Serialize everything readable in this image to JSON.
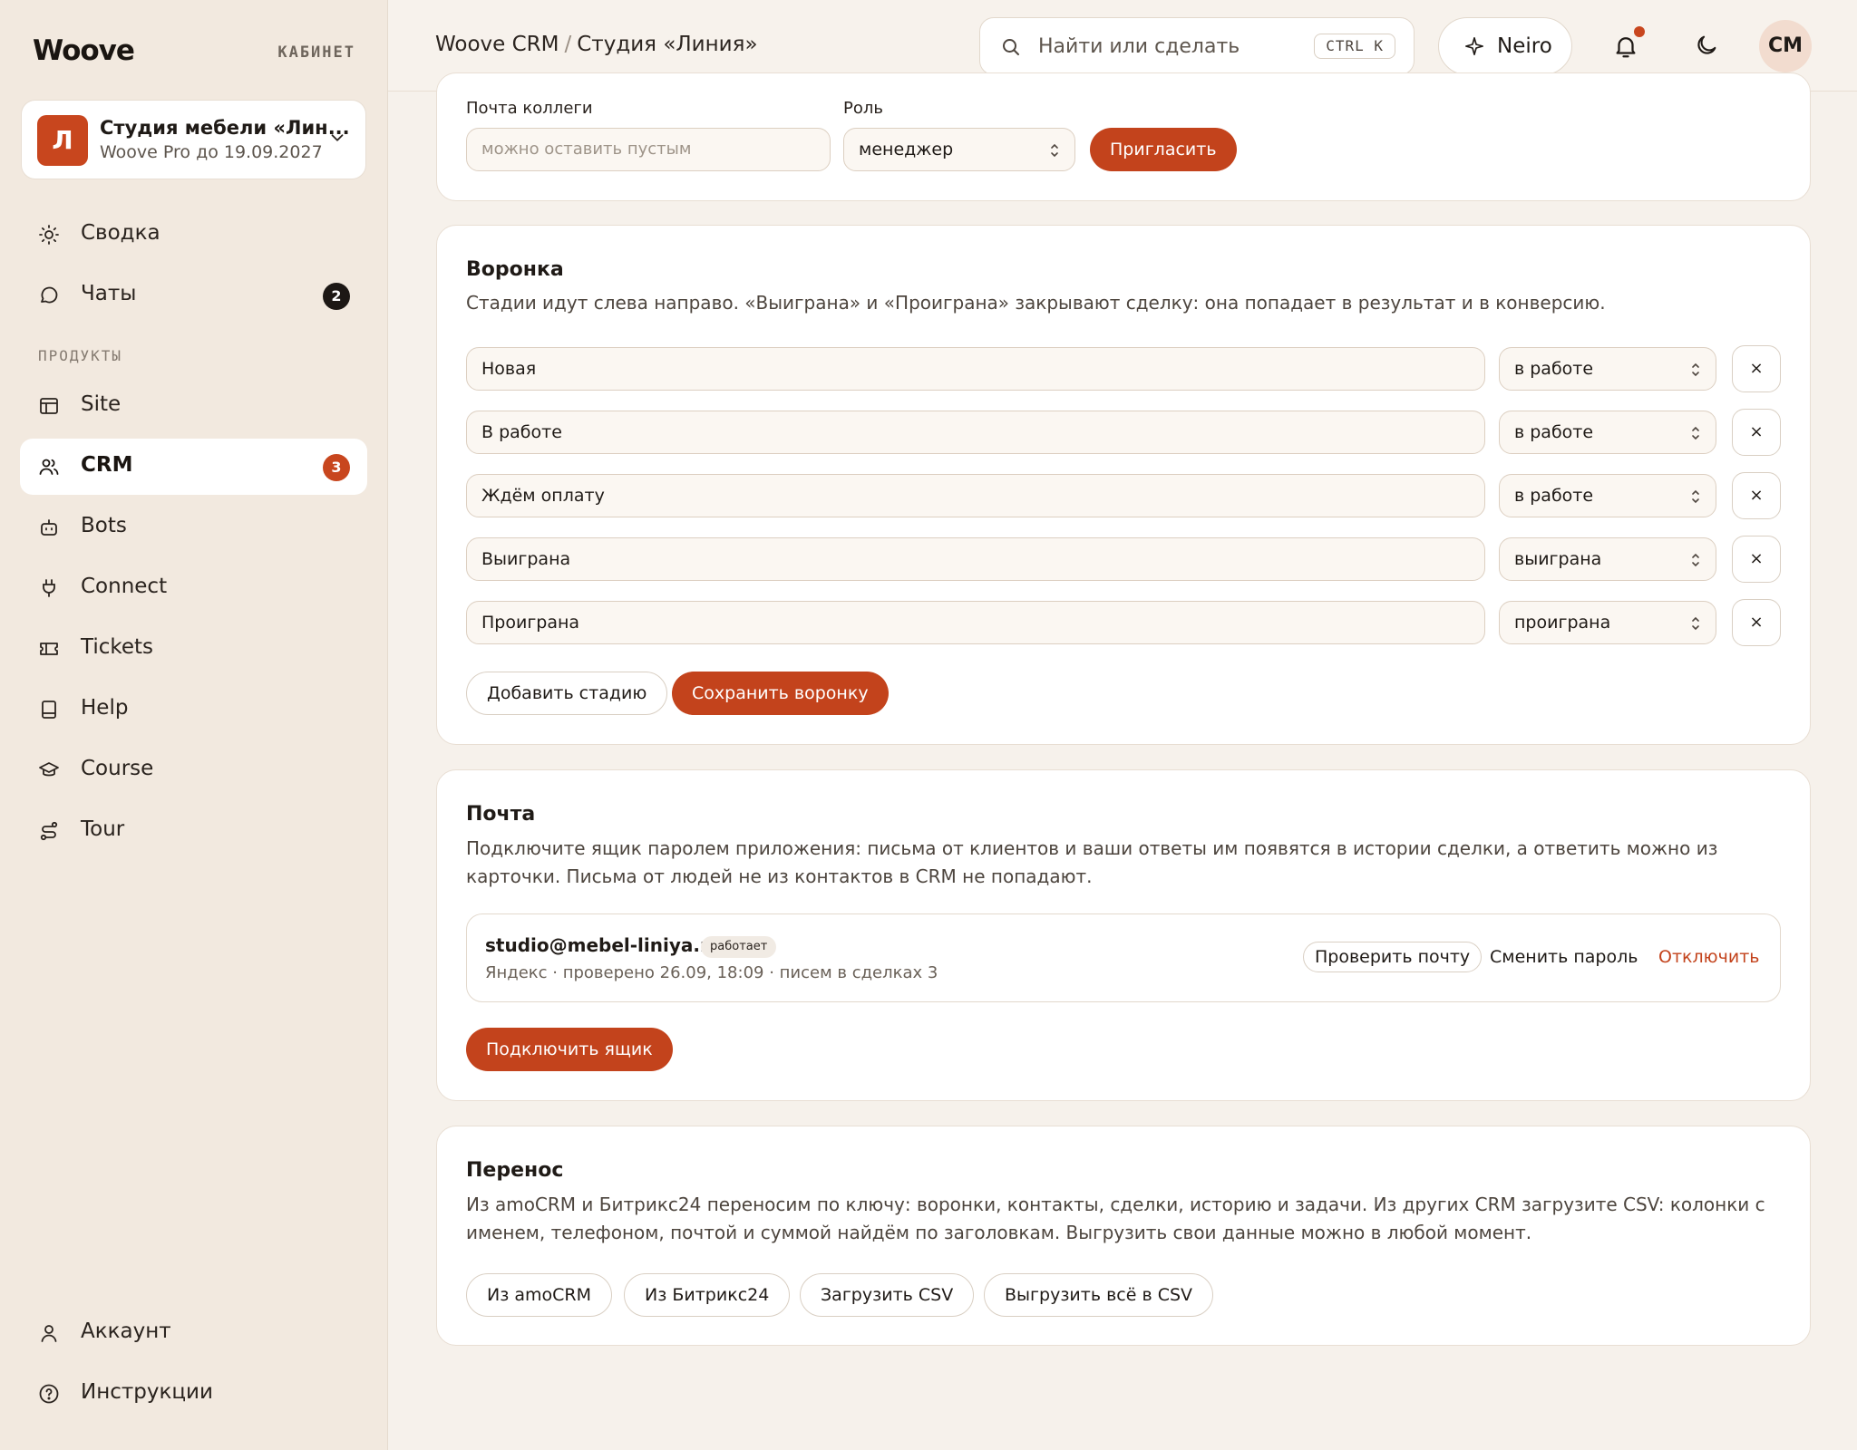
{
  "sidebar": {
    "brand": "Woove",
    "cabinet_label": "КАБИНЕТ",
    "org": {
      "initial": "Л",
      "name": "Студия мебели «Лин...",
      "plan": "Woove Pro до 19.09.2027"
    },
    "top_items": [
      {
        "label": "Сводка",
        "icon": "sun-icon"
      },
      {
        "label": "Чаты",
        "icon": "chat-bubble-icon",
        "badge": "2"
      }
    ],
    "products_label": "ПРОДУКТЫ",
    "product_items": [
      {
        "label": "Site",
        "icon": "layout-icon"
      },
      {
        "label": "CRM",
        "icon": "users-icon",
        "badge": "3",
        "active": true
      },
      {
        "label": "Bots",
        "icon": "robot-icon"
      },
      {
        "label": "Connect",
        "icon": "plug-icon"
      },
      {
        "label": "Tickets",
        "icon": "ticket-icon"
      },
      {
        "label": "Help",
        "icon": "book-icon"
      },
      {
        "label": "Course",
        "icon": "graduation-cap-icon"
      },
      {
        "label": "Tour",
        "icon": "route-icon"
      }
    ],
    "bottom_items": [
      {
        "label": "Аккаунт",
        "icon": "user-icon"
      },
      {
        "label": "Инструкции",
        "icon": "help-circle-icon"
      }
    ]
  },
  "header": {
    "crumb_root": "Woove CRM",
    "crumb_sep": "/",
    "crumb_current": "Студия «Линия»",
    "search_placeholder": "Найти или сделать",
    "search_shortcut": "CTRL K",
    "neiro_label": "Neiro",
    "avatar_initials": "СМ",
    "accent_color": "#c3431c"
  },
  "invite": {
    "email_label": "Почта коллеги",
    "email_placeholder": "можно оставить пустым",
    "role_label": "Роль",
    "role_value": "менеджер",
    "invite_button": "Пригласить"
  },
  "funnel": {
    "title": "Воронка",
    "description": "Стадии идут слева направо. «Выиграна» и «Проиграна» закрывают сделку: она попадает в результат и в конверсию.",
    "stages": [
      {
        "name": "Новая",
        "type": "в работе"
      },
      {
        "name": "В работе",
        "type": "в работе"
      },
      {
        "name": "Ждём оплату",
        "type": "в работе"
      },
      {
        "name": "Выиграна",
        "type": "выиграна"
      },
      {
        "name": "Проиграна",
        "type": "проиграна"
      }
    ],
    "remove_label": "×",
    "add_stage_button": "Добавить стадию",
    "save_button": "Сохранить воронку"
  },
  "mail": {
    "title": "Почта",
    "description": "Подключите ящик паролем приложения: письма от клиентов и ваши ответы им появятся в истории сделки, а ответить можно из карточки. Письма от людей не из контактов в CRM не попадают.",
    "mailbox": {
      "address": "studio@mebel-liniya.ru",
      "status": "работает",
      "meta": "Яндекс · проверено 26.09, 18:09 · писем в сделках 3",
      "check_button": "Проверить почту",
      "change_password": "Сменить пароль",
      "disconnect": "Отключить"
    },
    "connect_button": "Подключить ящик"
  },
  "transfer": {
    "title": "Перенос",
    "description": "Из amoCRM и Битрикс24 переносим по ключу: воронки, контакты, сделки, историю и задачи. Из других CRM загрузите CSV: колонки с именем, телефоном, почтой и суммой найдём по заголовкам. Выгрузить свои данные можно в любой момент.",
    "buttons": [
      "Из amoCRM",
      "Из Битрикс24",
      "Загрузить CSV",
      "Выгрузить всё в CSV"
    ]
  }
}
